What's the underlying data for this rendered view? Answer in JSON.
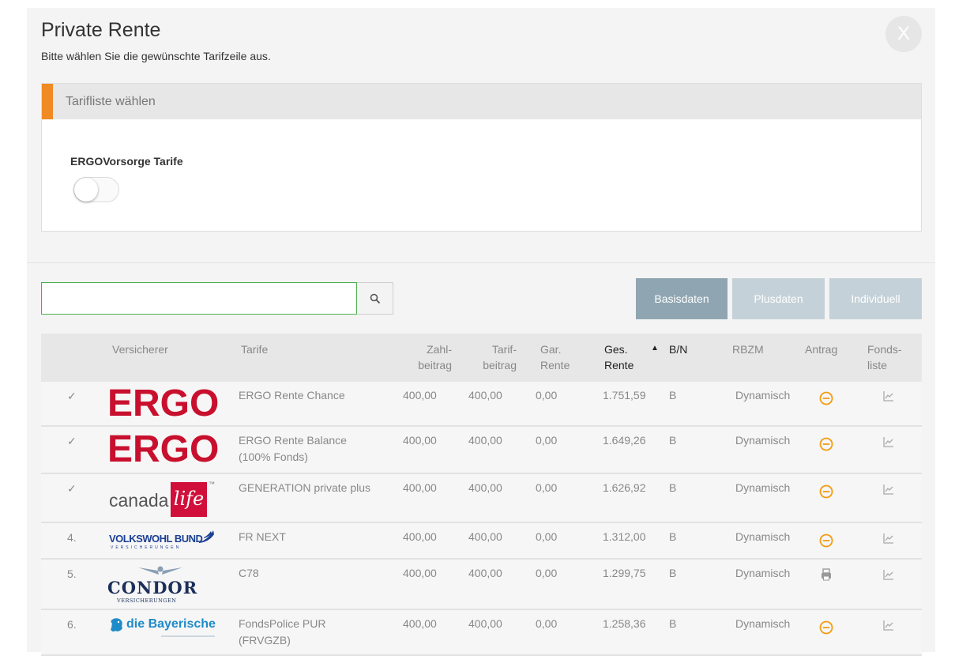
{
  "dialog": {
    "title": "Private Rente",
    "subtitle": "Bitte wählen Sie die gewünschte Tarifzeile aus.",
    "close_label": "X"
  },
  "tariff_list": {
    "header": "Tarifliste wählen",
    "toggle_label": "ERGOVorsorge Tarife",
    "toggle_on": false
  },
  "search": {
    "value": "",
    "placeholder": ""
  },
  "view_buttons": {
    "basisdaten": "Basisdaten",
    "plusdaten": "Plusdaten",
    "individuell": "Individuell",
    "active": "Basisdaten"
  },
  "colors": {
    "accent_orange": "#f08a24",
    "button_active": "#8fa5b2",
    "button_inactive": "#c5d1d8",
    "ergo_red": "#c8102e",
    "search_border": "#4caf50"
  },
  "table": {
    "columns": {
      "versicherer": "Versicherer",
      "tarife": "Tarife",
      "zahlbeitrag_1": "Zahl-",
      "zahlbeitrag_2": "beitrag",
      "tarifbeitrag_1": "Tarif-",
      "tarifbeitrag_2": "beitrag",
      "gar_rente_1": "Gar.",
      "gar_rente_2": "Rente",
      "ges_rente_1": "Ges.",
      "ges_rente_2": "Rente",
      "sort_indicator": "▲",
      "bn": "B/N",
      "rbzm": "RBZM",
      "antrag": "Antrag",
      "fondsliste_1": "Fonds-",
      "fondsliste_2": "liste"
    },
    "rows": [
      {
        "index": "✓",
        "insurer_logo": "ERGO",
        "tarif_1": "ERGO Rente Chance",
        "tarif_2": "",
        "zahlbeitrag": "400,00",
        "tarifbeitrag": "400,00",
        "gar_rente": "0,00",
        "ges_rente": "1.751,59",
        "bn": "B",
        "rbzm": "Dynamisch",
        "antrag_icon": "e-application-icon",
        "fonds_icon": "chart-icon"
      },
      {
        "index": "✓",
        "insurer_logo": "ERGO",
        "tarif_1": "ERGO Rente Balance",
        "tarif_2": "(100% Fonds)",
        "zahlbeitrag": "400,00",
        "tarifbeitrag": "400,00",
        "gar_rente": "0,00",
        "ges_rente": "1.649,26",
        "bn": "B",
        "rbzm": "Dynamisch",
        "antrag_icon": "e-application-icon",
        "fonds_icon": "chart-icon"
      },
      {
        "index": "✓",
        "insurer_logo_1": "canada",
        "insurer_logo_2": "life",
        "insurer_logo_tm": "™",
        "tarif_1": "GENERATION private plus",
        "tarif_2": "",
        "zahlbeitrag": "400,00",
        "tarifbeitrag": "400,00",
        "gar_rente": "0,00",
        "ges_rente": "1.626,92",
        "bn": "B",
        "rbzm": "Dynamisch",
        "antrag_icon": "e-application-icon",
        "fonds_icon": "chart-icon"
      },
      {
        "index": "4.",
        "insurer_logo": "VOLKSWOHL BUND",
        "insurer_logo_sub": "VERSICHERUNGEN",
        "tarif_1": "FR NEXT",
        "tarif_2": "",
        "zahlbeitrag": "400,00",
        "tarifbeitrag": "400,00",
        "gar_rente": "0,00",
        "ges_rente": "1.312,00",
        "bn": "B",
        "rbzm": "Dynamisch",
        "antrag_icon": "e-application-icon",
        "fonds_icon": "chart-icon"
      },
      {
        "index": "5.",
        "insurer_logo": "CONDOR",
        "insurer_logo_sub": "VERSICHERUNGEN",
        "tarif_1": "C78",
        "tarif_2": "",
        "zahlbeitrag": "400,00",
        "tarifbeitrag": "400,00",
        "gar_rente": "0,00",
        "ges_rente": "1.299,75",
        "bn": "B",
        "rbzm": "Dynamisch",
        "antrag_icon": "printer-icon",
        "fonds_icon": "chart-icon"
      },
      {
        "index": "6.",
        "insurer_logo": "die Bayerische",
        "tarif_1": "FondsPolice PUR",
        "tarif_2": "(FRVGZB)",
        "zahlbeitrag": "400,00",
        "tarifbeitrag": "400,00",
        "gar_rente": "0,00",
        "ges_rente": "1.258,36",
        "bn": "B",
        "rbzm": "Dynamisch",
        "antrag_icon": "e-application-icon",
        "fonds_icon": "chart-icon"
      }
    ]
  }
}
